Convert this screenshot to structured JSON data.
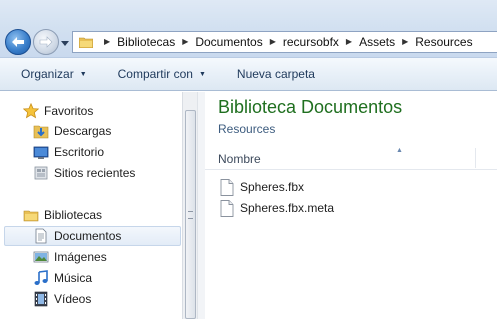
{
  "window": {
    "title": "Resources"
  },
  "navigation": {
    "back_icon": "back-arrow-icon",
    "forward_icon": "forward-arrow-icon",
    "history_dropdown_icon": "chevron-down-icon"
  },
  "address_bar": {
    "folder_icon": "folder-icon",
    "crumbs": [
      "Bibliotecas",
      "Documentos",
      "recursobfx",
      "Assets",
      "Resources"
    ]
  },
  "toolbar": {
    "organize_label": "Organizar",
    "share_label": "Compartir con",
    "new_folder_label": "Nueva carpeta"
  },
  "nav_pane": {
    "favorites": {
      "label": "Favoritos",
      "icon": "star-icon",
      "items": [
        {
          "label": "Descargas",
          "icon": "downloads-folder-icon"
        },
        {
          "label": "Escritorio",
          "icon": "desktop-icon"
        },
        {
          "label": "Sitios recientes",
          "icon": "recent-places-icon"
        }
      ]
    },
    "libraries": {
      "label": "Bibliotecas",
      "icon": "libraries-icon",
      "items": [
        {
          "label": "Documentos",
          "icon": "documents-icon",
          "selected": true
        },
        {
          "label": "Imágenes",
          "icon": "pictures-icon"
        },
        {
          "label": "Música",
          "icon": "music-icon"
        },
        {
          "label": "Vídeos",
          "icon": "videos-icon"
        }
      ]
    }
  },
  "content": {
    "library_title": "Biblioteca Documentos",
    "library_subtitle": "Resources",
    "column_name": "Nombre",
    "files": [
      {
        "name": "Spheres.fbx",
        "icon": "file-icon"
      },
      {
        "name": "Spheres.fbx.meta",
        "icon": "file-icon"
      }
    ]
  },
  "colors": {
    "title_green": "#1f6f1f",
    "toolbar_text": "#1e395b",
    "selection_bg": "#e3ecf7"
  }
}
